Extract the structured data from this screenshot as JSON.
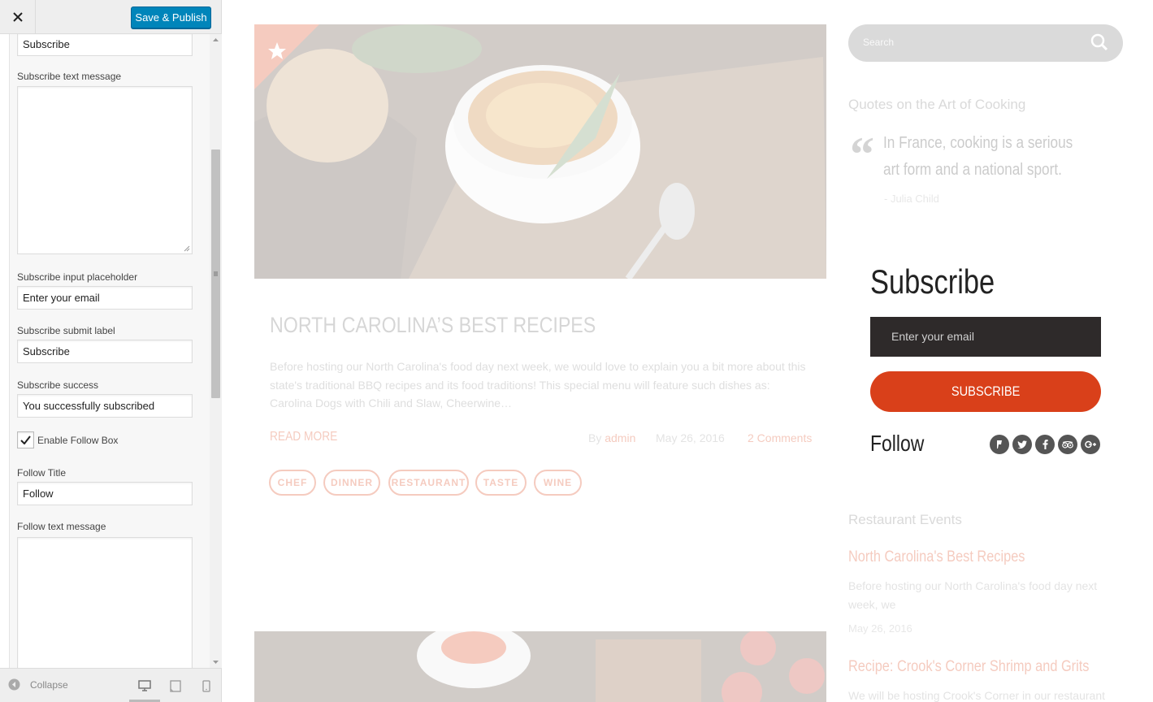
{
  "customizer": {
    "close_label": "×",
    "publish_label": "Save & Publish",
    "fields": {
      "title_value": "Subscribe",
      "text_message_label": "Subscribe text message",
      "input_placeholder_label": "Subscribe input placeholder",
      "input_placeholder_value": "Enter your email",
      "submit_label_label": "Subscribe submit label",
      "submit_label_value": "Subscribe",
      "success_label": "Subscribe success",
      "success_value": "You successfully subscribed",
      "enable_follow_label": "Enable Follow Box",
      "enable_follow_checked": true,
      "follow_title_label": "Follow Title",
      "follow_title_value": "Follow",
      "follow_text_label": "Follow text message"
    },
    "footer": {
      "collapse_label": "Collapse",
      "devices": [
        "desktop-icon",
        "tablet-icon",
        "mobile-icon"
      ]
    }
  },
  "preview": {
    "post": {
      "title": "NORTH CAROLINA’S BEST RECIPES",
      "excerpt": "Before hosting our North Carolina's food day next week, we would love to explain you a bit more about this state's traditional BBQ recipes and its food traditions! This special menu will feature such dishes as: Carolina Dogs with Chili and Slaw, Cheerwine…",
      "read_more": "READ MORE",
      "by": "By",
      "author": "admin",
      "date": "May 26, 2016",
      "comments": "2 Comments",
      "tags": [
        "CHEF",
        "DINNER",
        "RESTAURANT",
        "TASTE",
        "WINE"
      ]
    },
    "search": {
      "placeholder": "Search"
    },
    "quotes": {
      "title": "Quotes on the Art of Cooking",
      "text": "In France, cooking is a serious art form and a national sport.",
      "author": "- Julia Child"
    },
    "subscribe": {
      "title": "Subscribe",
      "placeholder": "Enter your email",
      "button": "SUBSCRIBE"
    },
    "follow": {
      "title": "Follow",
      "icons": [
        "foursquare-icon",
        "twitter-icon",
        "facebook-icon",
        "tripadvisor-icon",
        "google-plus-icon"
      ]
    },
    "events": {
      "title": "Restaurant Events",
      "items": [
        {
          "title": "North Carolina's Best Recipes",
          "text": "Before hosting our North Carolina's food day next week, we",
          "date": "May 26, 2016"
        },
        {
          "title": "Recipe: Crook's Corner Shrimp and Grits",
          "text": "We will be hosting Crook's Corner in our restaurant next"
        }
      ]
    },
    "accent_color": "#d9441c",
    "dark_color": "#2e2a2a"
  }
}
